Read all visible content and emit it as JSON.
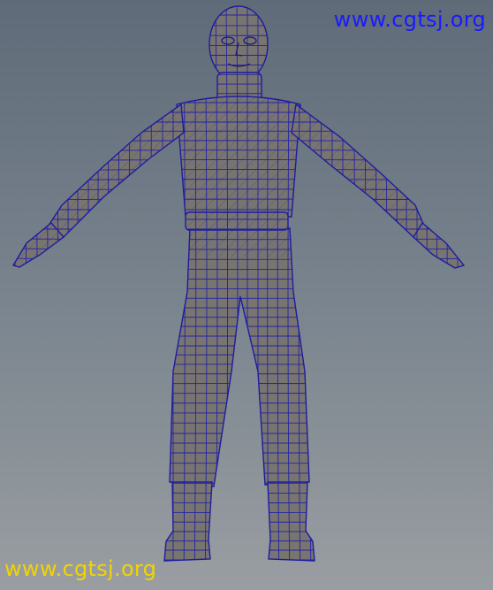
{
  "viewport": {
    "subject": "3d-humanoid-wireframe",
    "background_top": "#5f6b78",
    "background_bottom": "#9a9ea3",
    "mesh_fill": "#787570",
    "wire_color": "#1f1fa8"
  },
  "watermarks": [
    {
      "text": "www.cgtsj.org",
      "color": "#1a1aff"
    },
    {
      "text": "www.cgtsj.org",
      "color": "#f2d400"
    }
  ]
}
